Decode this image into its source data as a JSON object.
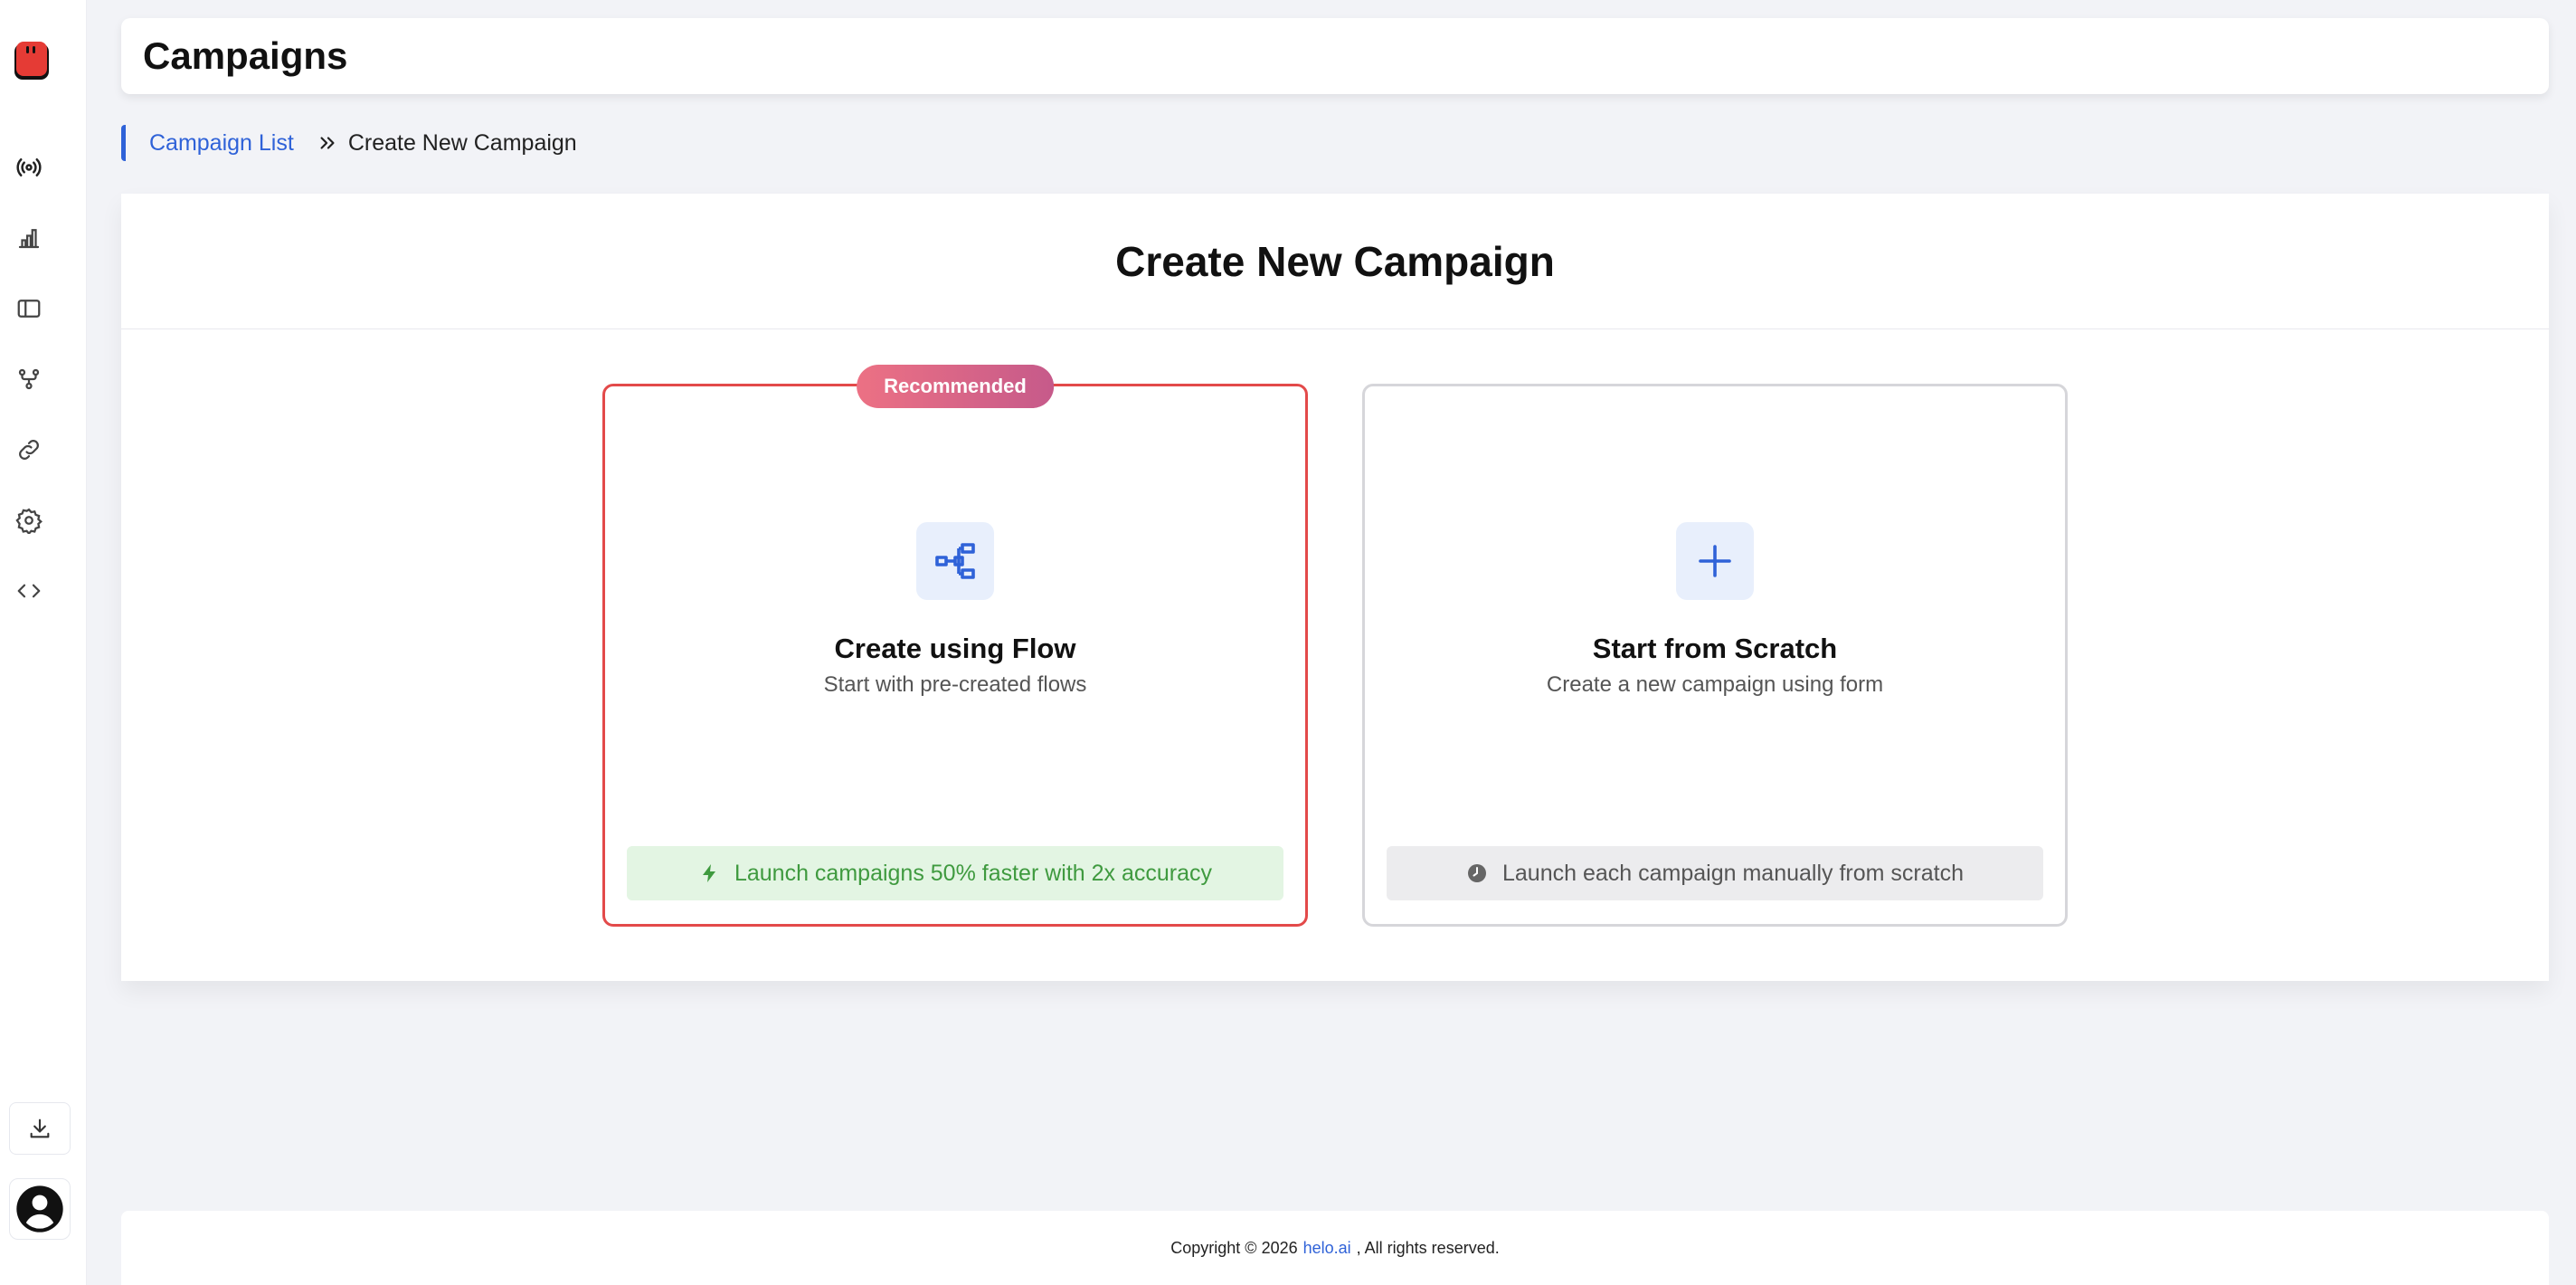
{
  "header": {
    "title": "Campaigns"
  },
  "breadcrumb": {
    "parent": "Campaign List",
    "current": "Create New Campaign"
  },
  "main": {
    "title": "Create New Campaign",
    "options": [
      {
        "badge": "Recommended",
        "icon": "flow-icon",
        "title": "Create using Flow",
        "subtitle": "Start with pre-created flows",
        "footer_icon": "lightning-icon",
        "footer": "Launch campaigns 50% faster with 2x accuracy"
      },
      {
        "icon": "plus-icon",
        "title": "Start from Scratch",
        "subtitle": "Create a new campaign using form",
        "footer_icon": "clock-icon",
        "footer": "Launch each campaign manually from scratch"
      }
    ]
  },
  "sidebar": {
    "items": [
      {
        "icon": "broadcast-icon"
      },
      {
        "icon": "bar-chart-icon"
      },
      {
        "icon": "panel-icon"
      },
      {
        "icon": "git-branch-icon"
      },
      {
        "icon": "link-icon"
      },
      {
        "icon": "gear-icon"
      },
      {
        "icon": "code-icon"
      }
    ]
  },
  "footer": {
    "prefix": "Copyright © 2026",
    "brand": "helo.ai",
    "suffix": ", All rights reserved."
  },
  "colors": {
    "accent": "#2f62d8",
    "recommended_border": "#e34a4a",
    "badge_start": "#ec7184",
    "badge_end": "#c65a8a",
    "success_text": "#3f9a3f",
    "success_bg": "#e3f5e3"
  }
}
